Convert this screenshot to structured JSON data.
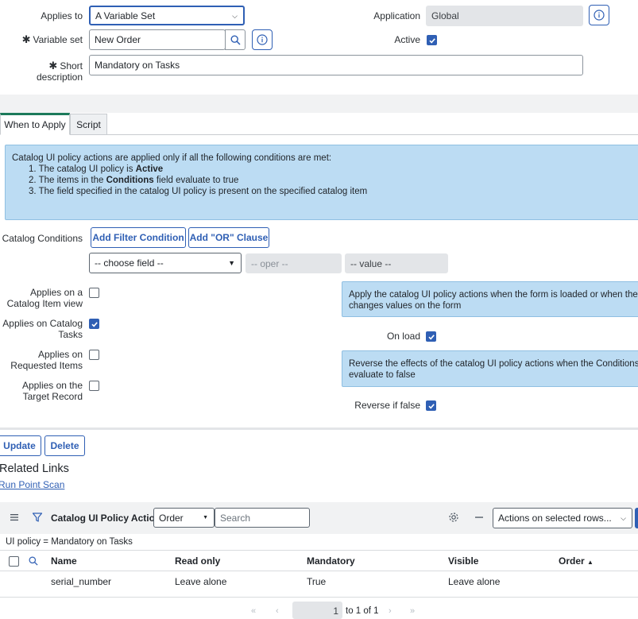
{
  "form": {
    "applies_to_label": "Applies to",
    "applies_to_value": "A Variable Set",
    "variable_set_label": "Variable set",
    "variable_set_value": "New Order",
    "short_desc_label_1": "Short",
    "short_desc_label_2": "description",
    "short_desc_value": "Mandatory on Tasks",
    "application_label": "Application",
    "application_value": "Global",
    "active_label": "Active",
    "active_checked": true
  },
  "tabs": [
    {
      "label": "When to Apply",
      "active": true
    },
    {
      "label": "Script",
      "active": false
    }
  ],
  "info": {
    "intro": "Catalog UI policy actions are applied only if all the following conditions are met:",
    "item1_pre": "1. The catalog UI policy is ",
    "item1_bold": "Active",
    "item2_pre": "2. The items in the ",
    "item2_bold": "Conditions",
    "item2_post": " field evaluate to true",
    "item3": "3. The field specified in the catalog UI policy is present on the specified catalog item"
  },
  "conditions": {
    "label": "Catalog Conditions",
    "add_filter": "Add Filter Condition",
    "add_or": "Add \"OR\" Clause",
    "field_placeholder": "-- choose field --",
    "oper_placeholder": "-- oper --",
    "value_placeholder": "-- value --"
  },
  "applies": [
    {
      "l1": "Applies on a",
      "l2": "Catalog Item view",
      "checked": false
    },
    {
      "l1": "Applies on Catalog",
      "l2": "Tasks",
      "checked": true
    },
    {
      "l1": "Applies on",
      "l2": "Requested Items",
      "checked": false
    },
    {
      "l1": "Applies on the",
      "l2": "Target Record",
      "checked": false
    }
  ],
  "onload": {
    "info_1": "Apply the catalog UI policy actions when the form is loaded or when the use",
    "info_2": "changes values on the form",
    "label": "On load",
    "checked": true
  },
  "reverse": {
    "info_1": "Reverse the effects of the catalog UI policy actions when the Conditions",
    "info_2": "evaluate to false",
    "label": "Reverse if false",
    "checked": true
  },
  "buttons": {
    "update": "Update",
    "delete": "Delete"
  },
  "related": {
    "title": "Related Links",
    "run_point_scan": "Run Point Scan"
  },
  "list": {
    "title": "Catalog UI Policy Actions",
    "search_field": "Order",
    "search_placeholder": "Search",
    "actions_select": "Actions on selected rows...",
    "breadcrumb": "UI policy = Mandatory on Tasks",
    "columns": {
      "name": "Name",
      "read_only": "Read only",
      "mandatory": "Mandatory",
      "visible": "Visible",
      "order": "Order"
    },
    "rows": [
      {
        "name": "serial_number",
        "read_only": "Leave alone",
        "mandatory": "True",
        "visible": "Leave alone",
        "order": ""
      }
    ]
  },
  "pagination": {
    "page": "1",
    "of_text": "to 1 of 1"
  },
  "colors": {
    "accent": "#2f5fb4",
    "tab_active": "#1c7a5a",
    "info_bg": "#bcdcf3"
  }
}
